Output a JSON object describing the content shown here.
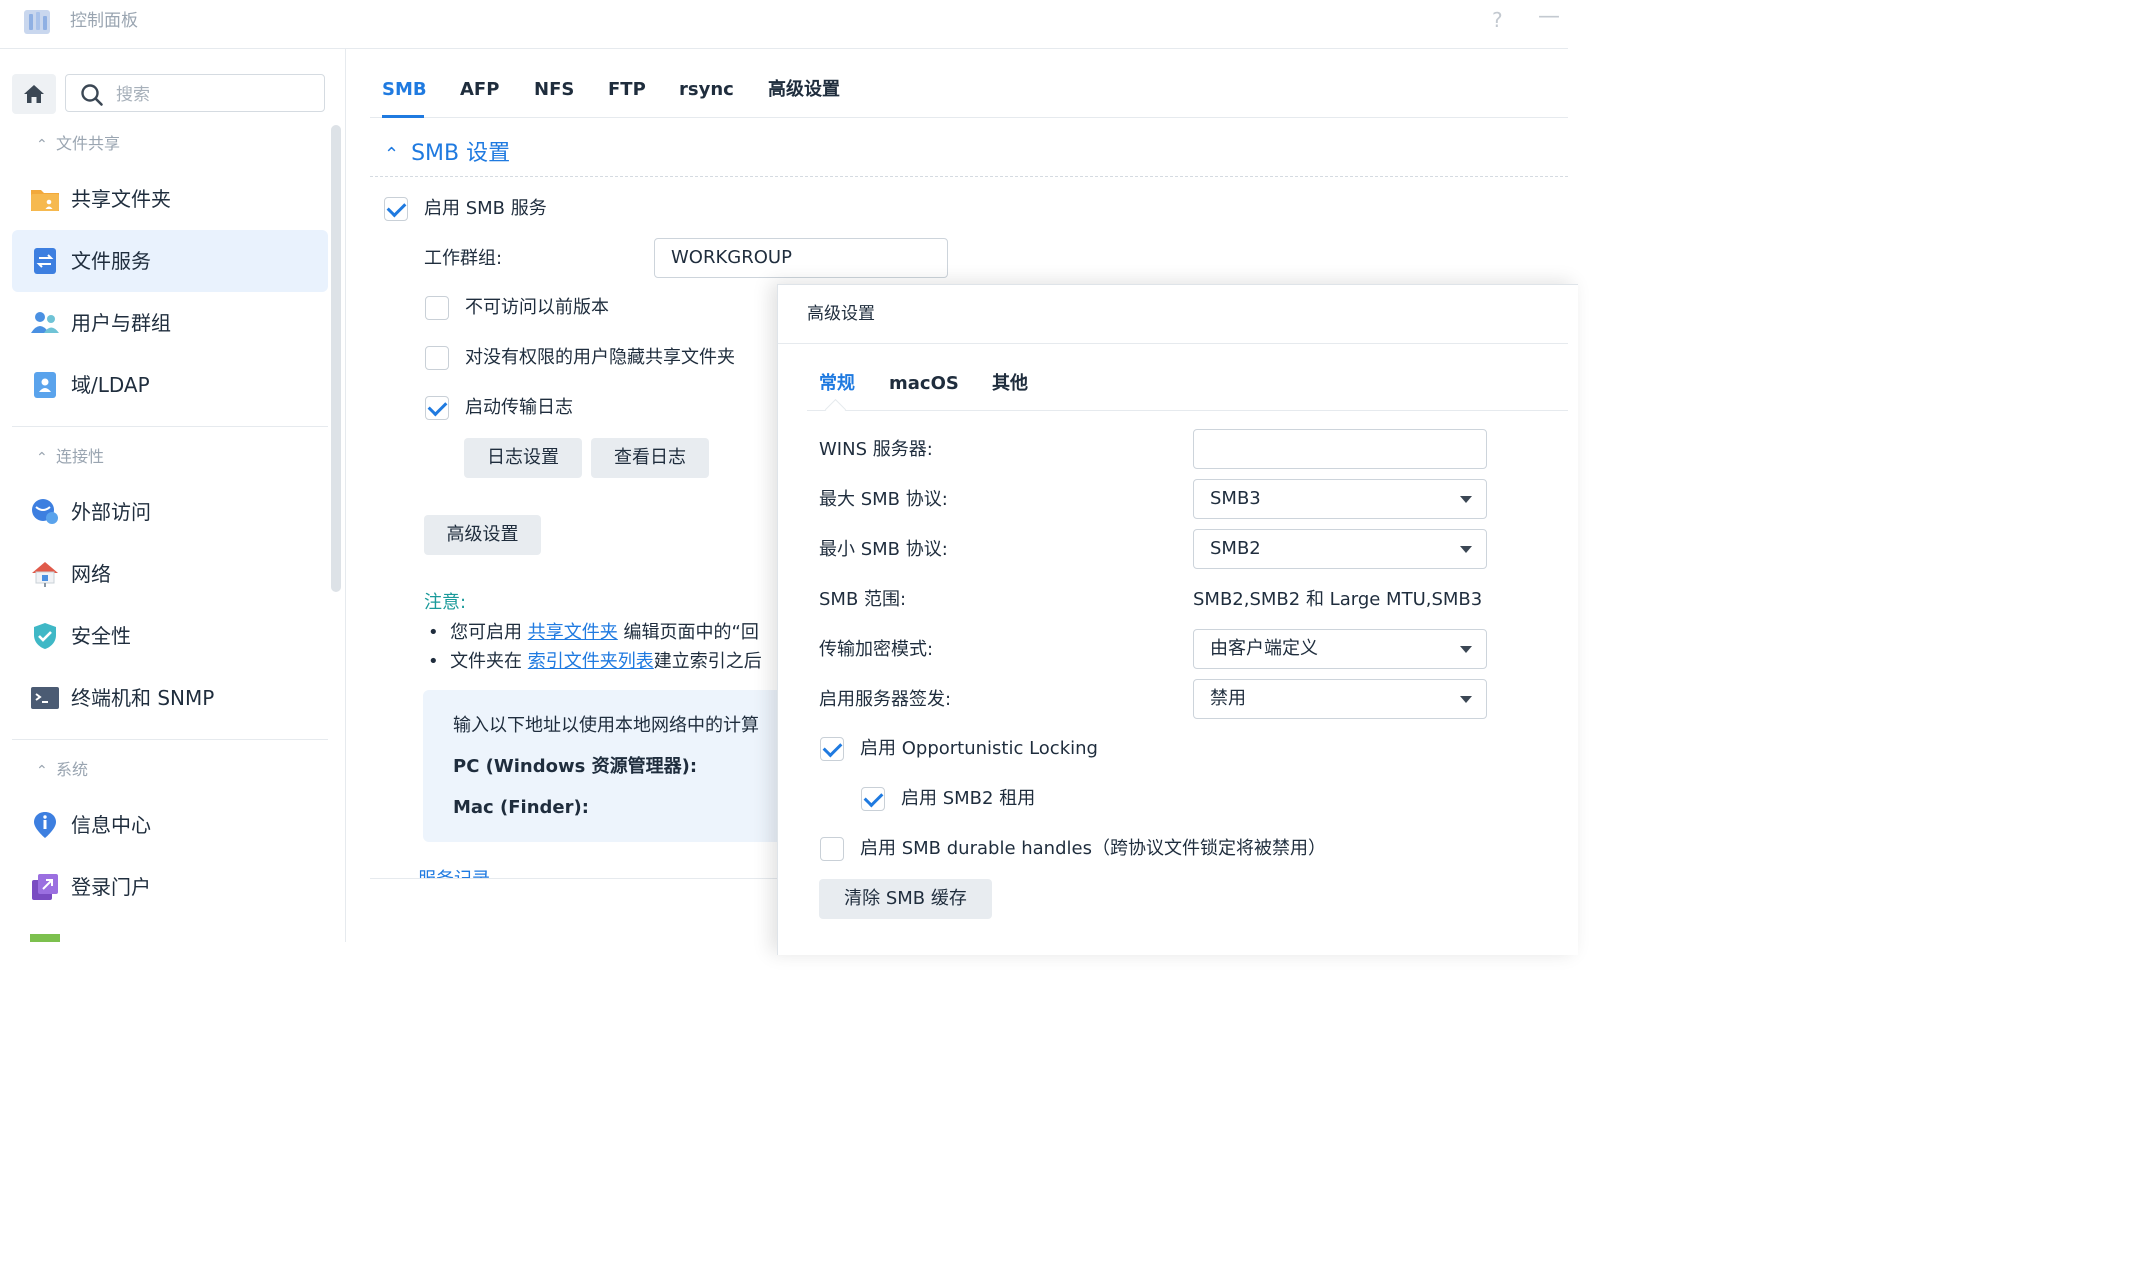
{
  "window": {
    "title": "控制面板",
    "help_symbol": "?",
    "minimize_symbol": "—"
  },
  "sidebar": {
    "search": {
      "placeholder": "搜索",
      "value": ""
    },
    "sections": [
      {
        "title": "文件共享",
        "items": [
          {
            "label": "共享文件夹",
            "icon": "shared-folder-icon"
          },
          {
            "label": "文件服务",
            "icon": "file-services-icon",
            "active": true
          },
          {
            "label": "用户与群组",
            "icon": "users-icon"
          },
          {
            "label": "域/LDAP",
            "icon": "ldap-icon"
          }
        ]
      },
      {
        "title": "连接性",
        "items": [
          {
            "label": "外部访问",
            "icon": "external-access-icon"
          },
          {
            "label": "网络",
            "icon": "network-icon"
          },
          {
            "label": "安全性",
            "icon": "security-shield-icon"
          },
          {
            "label": "终端机和 SNMP",
            "icon": "terminal-icon"
          }
        ]
      },
      {
        "title": "系统",
        "items": [
          {
            "label": "信息中心",
            "icon": "info-center-icon"
          },
          {
            "label": "登录门户",
            "icon": "login-portal-icon"
          }
        ]
      }
    ]
  },
  "main": {
    "tabs": [
      "SMB",
      "AFP",
      "NFS",
      "FTP",
      "rsync",
      "高级设置"
    ],
    "active_tab": "SMB",
    "section_title": "SMB 设置",
    "enable_smb": {
      "label": "启用 SMB 服务",
      "checked": true
    },
    "workgroup": {
      "label": "工作群组:",
      "value": "WORKGROUP"
    },
    "options": [
      {
        "label": "不可访问以前版本",
        "checked": false
      },
      {
        "label": "对没有权限的用户隐藏共享文件夹",
        "checked": false
      },
      {
        "label": "启动传输日志",
        "checked": true
      }
    ],
    "log_settings_button": "日志设置",
    "view_log_button": "查看日志",
    "advanced_button": "高级设置",
    "note": {
      "title": "注意:",
      "line1_prefix": "您可启用",
      "line1_link": "共享文件夹",
      "line1_suffix": "编辑页面中的“回",
      "line2_prefix": "文件夹在",
      "line2_link": "索引文件夹列表",
      "line2_suffix": "建立索引之后"
    },
    "info_box": {
      "intro": "输入以下地址以使用本地网络中的计算",
      "pc_label": "PC (Windows 资源管理器):",
      "mac_label": "Mac (Finder):"
    },
    "cut_off_link": "服务记录"
  },
  "dialog": {
    "title": "高级设置",
    "tabs": [
      "常规",
      "macOS",
      "其他"
    ],
    "active_tab": "常规",
    "wins": {
      "label": "WINS 服务器:",
      "value": ""
    },
    "max_smb": {
      "label": "最大 SMB 协议:",
      "value": "SMB3"
    },
    "min_smb": {
      "label": "最小 SMB 协议:",
      "value": "SMB2"
    },
    "smb_range": {
      "label": "SMB 范围:",
      "value": "SMB2,SMB2 和 Large MTU,SMB3"
    },
    "encryption": {
      "label": "传输加密模式:",
      "value": "由客户端定义"
    },
    "signing": {
      "label": "启用服务器签发:",
      "value": "禁用"
    },
    "oplock": {
      "label": "启用 Opportunistic Locking",
      "checked": true
    },
    "smb2_lease": {
      "label": "启用 SMB2 租用",
      "checked": true
    },
    "durable": {
      "label": "启用 SMB durable handles（跨协议文件锁定将被禁用）",
      "checked": false
    },
    "clear_cache_button": "清除 SMB 缓存"
  },
  "colors": {
    "accent": "#1f7ae0",
    "note": "#1a9a9a",
    "active_bg": "#e9f2fd"
  }
}
